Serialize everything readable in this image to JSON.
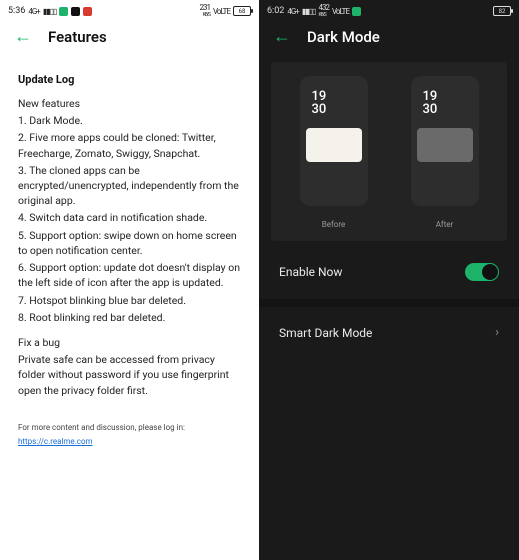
{
  "left": {
    "statusbar": {
      "time": "5:36",
      "net_label": "4G+",
      "signal_glyph": "▮▮▯▯",
      "wifi_glyph": "◦",
      "rate_label": "231",
      "rate_unit": "KB/S",
      "volte_label": "VoLTE",
      "battery_text": "68"
    },
    "header": {
      "title": "Features"
    },
    "update_log_title": "Update Log",
    "new_features_label": "New features",
    "features": [
      "1. Dark Mode.",
      "2. Five more apps could be cloned: Twitter, Freecharge, Zomato, Swiggy, Snapchat.",
      "3. The cloned apps can be encrypted/unencrypted, independently from the original app.",
      "4. Switch data card in notification shade.",
      "5. Support option: swipe down on home screen to open notification center.",
      "6. Support option: update dot doesn't display on the left side of icon after the app is updated.",
      "7. Hotspot blinking blue bar deleted.",
      "8. Root blinking red bar deleted."
    ],
    "fix_label": "Fix a bug",
    "fix_text": "Private safe can be accessed from privacy folder without password if you use fingerprint open the privacy folder first.",
    "footer_text": "For more content and discussion, please log in:",
    "footer_link": "https://c.realme.com"
  },
  "right": {
    "statusbar": {
      "time": "6:02",
      "net_label": "4G+",
      "signal_glyph": "▮▮▯▯",
      "rate_label": "432",
      "rate_unit": "KB/S",
      "volte_label": "VoLTE",
      "battery_text": "82"
    },
    "header": {
      "title": "Dark Mode"
    },
    "preview": {
      "time_display": "19\n30",
      "before_label": "Before",
      "after_label": "After"
    },
    "enable_row": {
      "label": "Enable Now",
      "on": true
    },
    "smart_row": {
      "label": "Smart Dark Mode"
    }
  }
}
